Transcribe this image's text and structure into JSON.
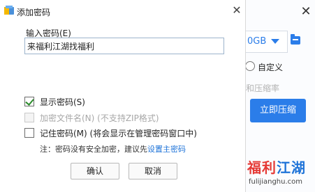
{
  "background": {
    "size_value": "0GB",
    "radio_custom_label": "自定义",
    "ratio_label": "和压缩率",
    "compress_button": "立即压缩",
    "logo_part1": "福利",
    "logo_part2": "江湖",
    "site": "fulijianghu.com"
  },
  "dialog": {
    "title": "添加密码",
    "password_label": "输入密码(E)",
    "password_value": "来福利江湖找福利",
    "show_password_label": "显示密码(S)",
    "show_password_checked": true,
    "encrypt_filenames_label": "加密文件名(N) (不支持ZIP格式)",
    "encrypt_filenames_enabled": false,
    "remember_password_label": "记住密码(M) (将会显示在管理密码窗口中)",
    "remember_password_checked": false,
    "note_text": "注：密码没有安全加密，建议先",
    "note_link": "设置主密码",
    "ok_label": "确认",
    "cancel_label": "取消"
  },
  "colors": {
    "accent": "#2b7de9",
    "link": "#1e73d8",
    "logo_red": "#e53935"
  }
}
